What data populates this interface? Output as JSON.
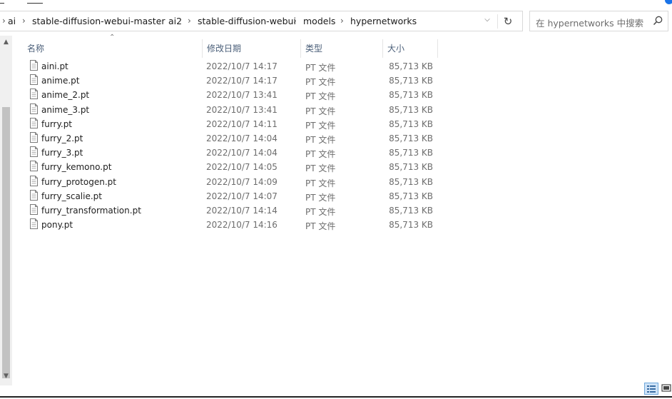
{
  "address": {
    "breadcrumbs": [
      "ai",
      "stable-diffusion-webui-master",
      "ai2",
      "stable-diffusion-webui",
      "models",
      "hypernetworks"
    ]
  },
  "search": {
    "placeholder": "在 hypernetworks 中搜索"
  },
  "columns": {
    "name": "名称",
    "date": "修改日期",
    "type": "类型",
    "size": "大小"
  },
  "files": [
    {
      "name": "aini.pt",
      "date": "2022/10/7 14:17",
      "type": "PT 文件",
      "size": "85,713 KB"
    },
    {
      "name": "anime.pt",
      "date": "2022/10/7 14:17",
      "type": "PT 文件",
      "size": "85,713 KB"
    },
    {
      "name": "anime_2.pt",
      "date": "2022/10/7 13:41",
      "type": "PT 文件",
      "size": "85,713 KB"
    },
    {
      "name": "anime_3.pt",
      "date": "2022/10/7 13:41",
      "type": "PT 文件",
      "size": "85,713 KB"
    },
    {
      "name": "furry.pt",
      "date": "2022/10/7 14:11",
      "type": "PT 文件",
      "size": "85,713 KB"
    },
    {
      "name": "furry_2.pt",
      "date": "2022/10/7 14:04",
      "type": "PT 文件",
      "size": "85,713 KB"
    },
    {
      "name": "furry_3.pt",
      "date": "2022/10/7 14:04",
      "type": "PT 文件",
      "size": "85,713 KB"
    },
    {
      "name": "furry_kemono.pt",
      "date": "2022/10/7 14:05",
      "type": "PT 文件",
      "size": "85,713 KB"
    },
    {
      "name": "furry_protogen.pt",
      "date": "2022/10/7 14:09",
      "type": "PT 文件",
      "size": "85,713 KB"
    },
    {
      "name": "furry_scalie.pt",
      "date": "2022/10/7 14:07",
      "type": "PT 文件",
      "size": "85,713 KB"
    },
    {
      "name": "furry_transformation.pt",
      "date": "2022/10/7 14:14",
      "type": "PT 文件",
      "size": "85,713 KB"
    },
    {
      "name": "pony.pt",
      "date": "2022/10/7 14:16",
      "type": "PT 文件",
      "size": "85,713 KB"
    }
  ],
  "icons": {
    "file": "generic-file-icon",
    "refresh": "refresh-icon",
    "search": "search-icon",
    "dropdown": "chevron-down-icon",
    "details_view": "details-view-icon",
    "tiles_view": "large-icons-view-icon"
  },
  "colors": {
    "header_text": "#4c607a",
    "selected_view": "#cfe3f7",
    "accent": "#1a73e8"
  }
}
